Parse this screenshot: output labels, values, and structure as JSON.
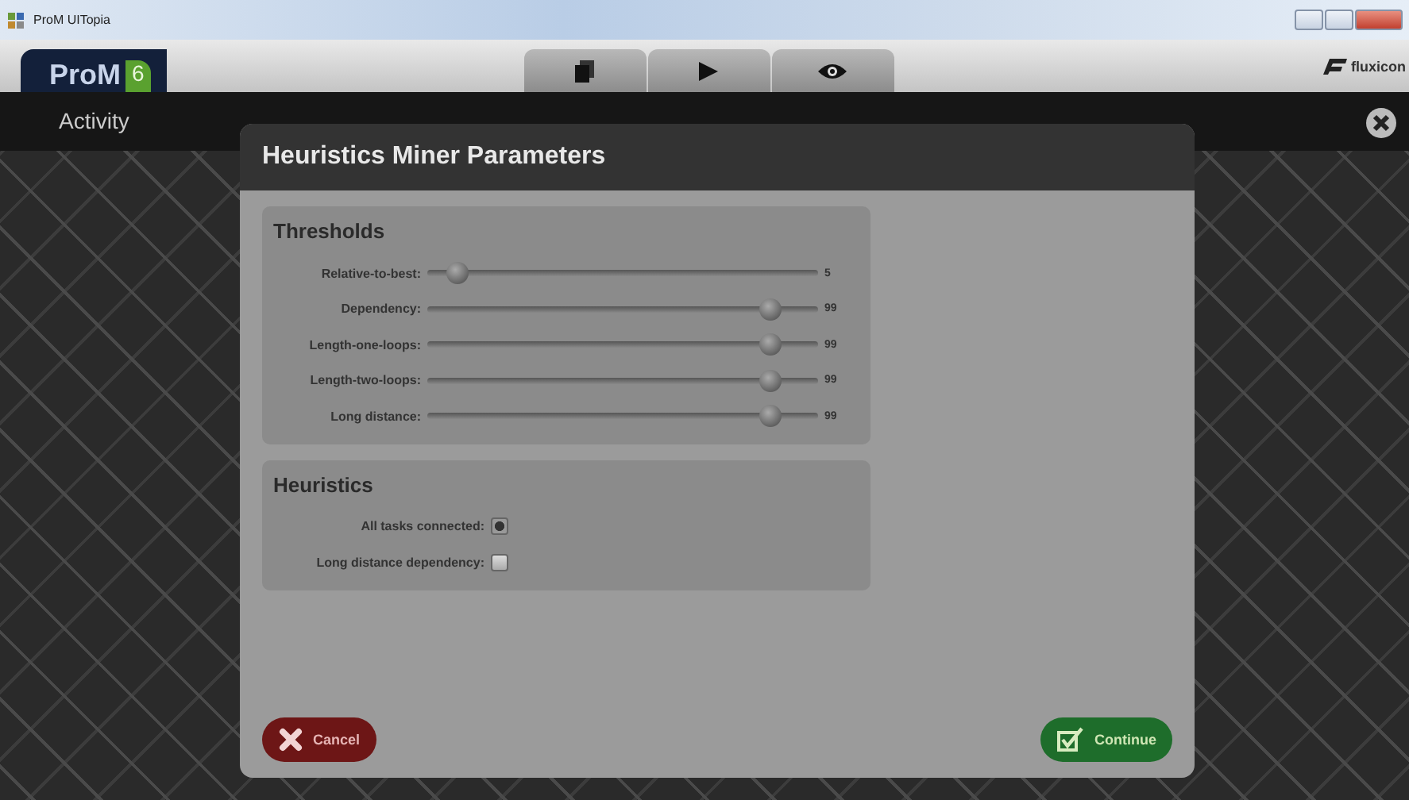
{
  "window": {
    "title": "ProM UITopia"
  },
  "header": {
    "logo": "ProM",
    "logo_version": "6",
    "brand": "fluxicon"
  },
  "activity": {
    "title": "Activity"
  },
  "dialog": {
    "title": "Heuristics Miner Parameters",
    "sections": [
      {
        "title": "Thresholds",
        "rows": [
          {
            "kind": "slider",
            "label": "Relative-to-best:",
            "level": 0.05,
            "reading": "5"
          },
          {
            "kind": "slider",
            "label": "Dependency:",
            "level": 0.9,
            "reading": "99"
          },
          {
            "kind": "slider",
            "label": "Length-one-loops:",
            "level": 0.9,
            "reading": "99"
          },
          {
            "kind": "slider",
            "label": "Length-two-loops:",
            "level": 0.9,
            "reading": "99"
          },
          {
            "kind": "slider",
            "label": "Long distance:",
            "level": 0.9,
            "reading": "99"
          }
        ]
      },
      {
        "title": "Heuristics",
        "rows": [
          {
            "kind": "checkbox",
            "label": "All tasks connected:",
            "checked": true
          },
          {
            "kind": "checkbox",
            "label": "Long distance dependency:",
            "checked": false
          }
        ]
      }
    ],
    "buttons": [
      {
        "kind": "cancel",
        "label": "Cancel"
      },
      {
        "kind": "continue",
        "label": "Continue"
      }
    ]
  }
}
